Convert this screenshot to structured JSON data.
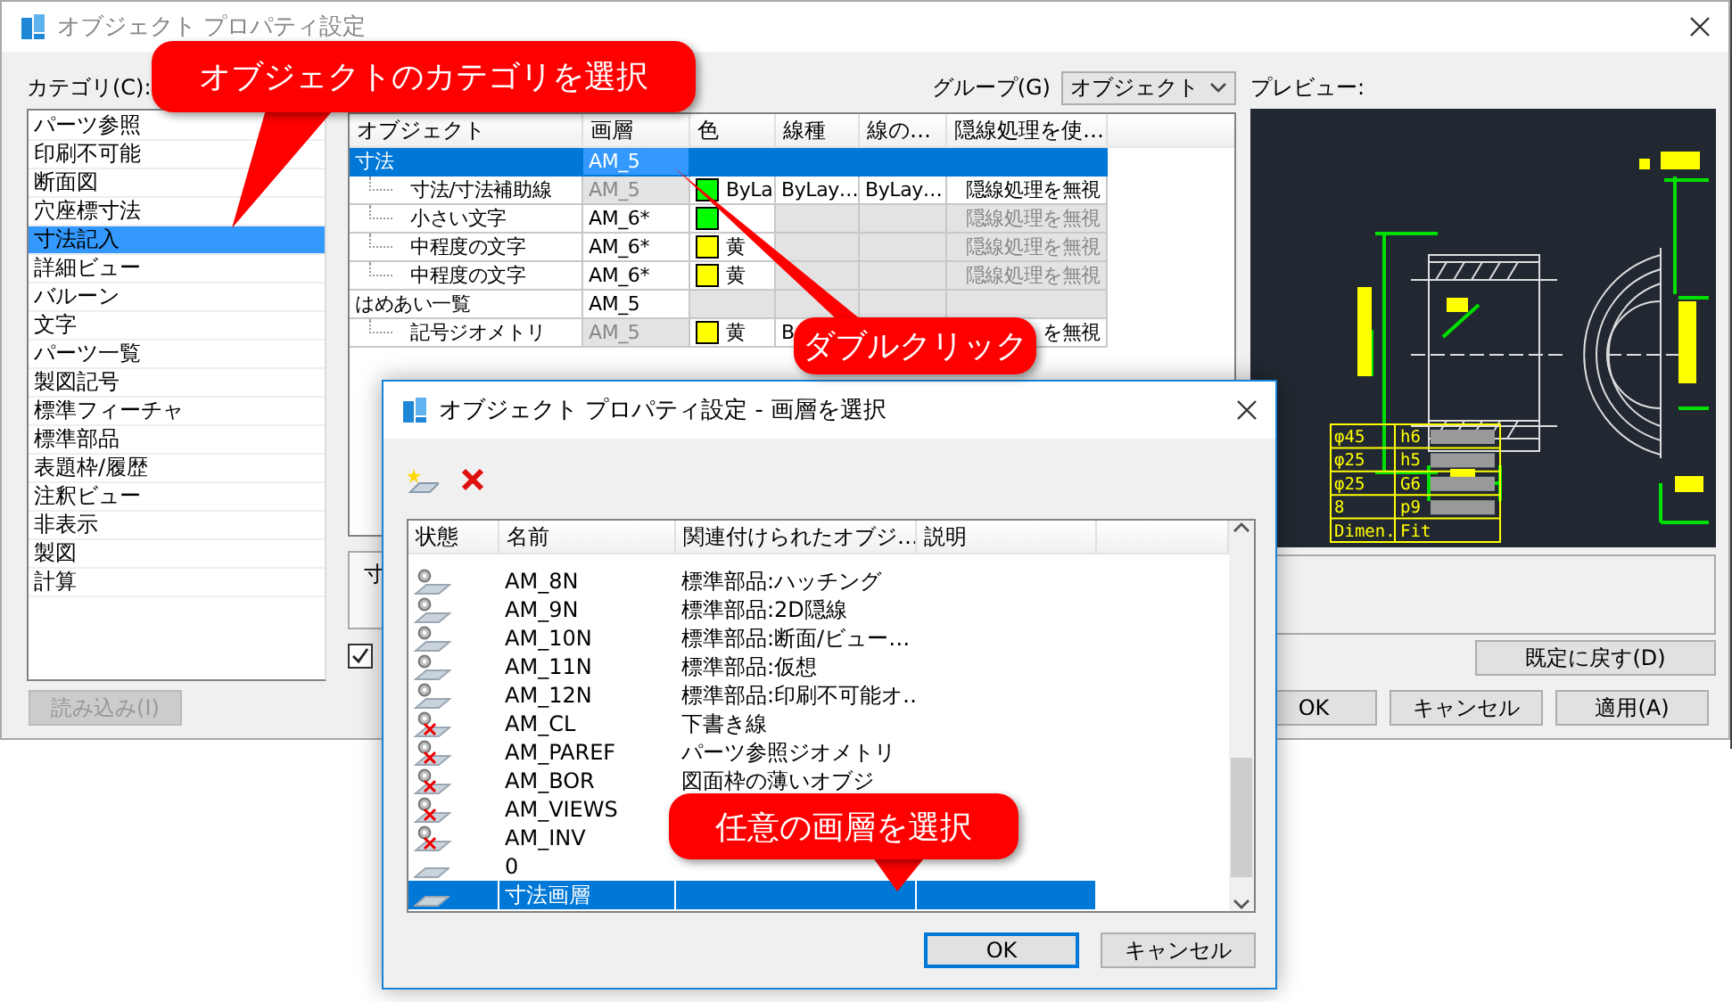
{
  "main_window": {
    "title": "オブジェクト プロパティ設定",
    "category_label": "カテゴリ(C):",
    "categories": [
      {
        "label": "パーツ参照",
        "selected": false
      },
      {
        "label": "印刷不可能",
        "selected": false
      },
      {
        "label": "断面図",
        "selected": false
      },
      {
        "label": "穴座標寸法",
        "selected": false
      },
      {
        "label": "寸法記入",
        "selected": true
      },
      {
        "label": "詳細ビュー",
        "selected": false
      },
      {
        "label": "バルーン",
        "selected": false
      },
      {
        "label": "文字",
        "selected": false
      },
      {
        "label": "パーツ一覧",
        "selected": false
      },
      {
        "label": "製図記号",
        "selected": false
      },
      {
        "label": "標準フィーチャ",
        "selected": false
      },
      {
        "label": "標準部品",
        "selected": false
      },
      {
        "label": "表題枠/履歴",
        "selected": false
      },
      {
        "label": "注釈ビュー",
        "selected": false
      },
      {
        "label": "非表示",
        "selected": false
      },
      {
        "label": "製図",
        "selected": false
      },
      {
        "label": "計算",
        "selected": false
      }
    ],
    "load_button": {
      "label": "読み込み(I)",
      "disabled": true
    },
    "group_label": "グループ(G)",
    "group_value": "オブジェクト",
    "columns": [
      "オブジェクト",
      "画層",
      "色",
      "線種",
      "線の…",
      "隠線処理を使…"
    ],
    "rows": [
      {
        "name": "寸法",
        "selected": true,
        "layer": {
          "text": "AM_5",
          "inherited": false
        },
        "color": {
          "inherited": false
        },
        "linetype": {
          "inherited": false
        },
        "lineweight": {
          "inherited": false
        },
        "hidden": {
          "inherited": false
        },
        "children": [
          {
            "name": "寸法/寸法補助線",
            "selected": false,
            "layer": {
              "text": "AM_5",
              "inherited": true
            },
            "color": {
              "text": "ByLa",
              "color": "#00ff00",
              "inherited": false
            },
            "linetype": {
              "text": "ByLay…",
              "inherited": false
            },
            "lineweight": {
              "text": "ByLay…",
              "inherited": false
            },
            "hidden": {
              "text": "隠線処理を無視",
              "inherited": false
            }
          },
          {
            "name": "小さい文字",
            "selected": false,
            "layer": {
              "text": "AM_6*",
              "inherited": false
            },
            "color": {
              "color": "#00ff00",
              "inherited": false
            },
            "linetype": {
              "inherited": true
            },
            "lineweight": {
              "inherited": true
            },
            "hidden": {
              "text": "隠線処理を無視",
              "inherited": true
            }
          },
          {
            "name": "中程度の文字",
            "selected": false,
            "layer": {
              "text": "AM_6*",
              "inherited": false
            },
            "color": {
              "text": "黄",
              "color": "#ffff00",
              "inherited": false
            },
            "linetype": {
              "inherited": true
            },
            "lineweight": {
              "inherited": true
            },
            "hidden": {
              "text": "隠線処理を無視",
              "inherited": true
            }
          },
          {
            "name": "中程度の文字",
            "selected": false,
            "layer": {
              "text": "AM_6*",
              "inherited": false
            },
            "color": {
              "text": "黄",
              "color": "#ffff00",
              "inherited": false
            },
            "linetype": {
              "inherited": true
            },
            "lineweight": {
              "inherited": true
            },
            "hidden": {
              "text": "隠線処理を無視",
              "inherited": true
            }
          }
        ]
      },
      {
        "name": "はめあい一覧",
        "selected": false,
        "layer": {
          "text": "AM_5",
          "inherited": false
        },
        "color": {
          "inherited": true
        },
        "linetype": {
          "inherited": true
        },
        "lineweight": {
          "inherited": true
        },
        "hidden": {
          "inherited": true
        },
        "children": [
          {
            "name": "記号ジオメトリ",
            "selected": false,
            "layer": {
              "text": "AM_5",
              "inherited": true
            },
            "color": {
              "text": "黄",
              "color": "#ffff00",
              "inherited": false
            },
            "linetype": {
              "text": "B",
              "inherited": false
            },
            "hidden": {
              "text": "を無視",
              "inherited": false
            }
          }
        ]
      }
    ],
    "note_text": "寸",
    "overlay_checkbox": {
      "checked": true
    },
    "preview_label": "プレビュー:",
    "preview": {
      "fit_table": [
        [
          "φ45",
          "h6"
        ],
        [
          "φ25",
          "h5"
        ],
        [
          "φ25",
          "G6"
        ],
        [
          "8",
          "p9"
        ],
        [
          "Dimen.",
          "Fit"
        ]
      ]
    },
    "reset_button": "既定に戻す(D)",
    "buttons": [
      {
        "label": "OK"
      },
      {
        "label": "キャンセル"
      },
      {
        "label": "適用(A)"
      }
    ]
  },
  "layer_dialog": {
    "title": "オブジェクト プロパティ設定 - 画層を選択",
    "columns": [
      "状態",
      "名前",
      "関連付けられたオブジ…",
      "説明"
    ],
    "layers": [
      {
        "kind": "gear",
        "name": "AM_8N",
        "object": "標準部品:ハッチング",
        "selected": false
      },
      {
        "kind": "gear",
        "name": "AM_9N",
        "object": "標準部品:2D隠線",
        "selected": false
      },
      {
        "kind": "gear",
        "name": "AM_10N",
        "object": "標準部品:断面/ビュー…",
        "selected": false
      },
      {
        "kind": "gear",
        "name": "AM_11N",
        "object": "標準部品:仮想",
        "selected": false
      },
      {
        "kind": "gear",
        "name": "AM_12N",
        "object": "標準部品:印刷不可能オ…",
        "selected": false
      },
      {
        "kind": "gear_off",
        "name": "AM_CL",
        "object": "下書き線",
        "selected": false
      },
      {
        "kind": "gear_off",
        "name": "AM_PAREF",
        "object": "パーツ参照ジオメトリ",
        "selected": false
      },
      {
        "kind": "gear_off",
        "name": "AM_BOR",
        "object": "図面枠の薄いオブジ",
        "selected": false
      },
      {
        "kind": "gear_off",
        "name": "AM_VIEWS",
        "selected": false
      },
      {
        "kind": "gear_off",
        "name": "AM_INV",
        "selected": false
      },
      {
        "kind": "plain",
        "name": "0",
        "selected": false
      },
      {
        "kind": "plain",
        "name": "寸法画層",
        "selected": true
      }
    ],
    "buttons": [
      {
        "label": "OK",
        "default": true
      },
      {
        "label": "キャンセル",
        "default": false
      }
    ]
  },
  "callouts": [
    {
      "text": "オブジェクトのカテゴリを選択"
    },
    {
      "text": "ダブルクリック"
    },
    {
      "text": "任意の画層を選択"
    }
  ]
}
